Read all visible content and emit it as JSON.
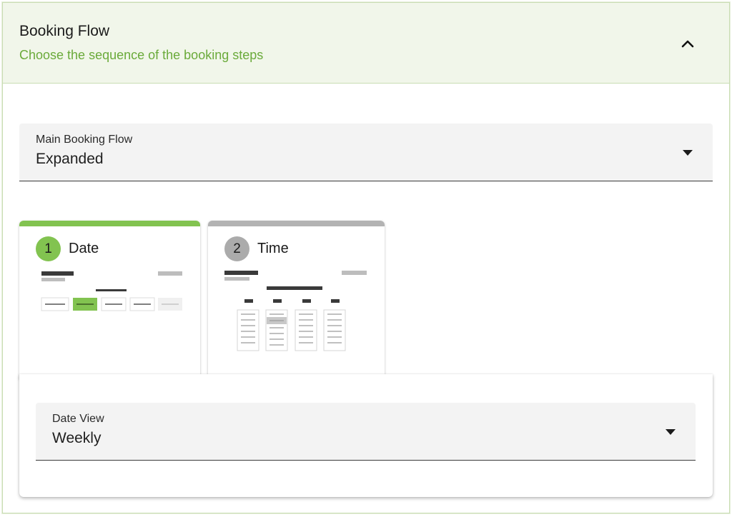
{
  "panel": {
    "title": "Booking Flow",
    "subtitle": "Choose the sequence of the booking steps",
    "collapse_icon": "chevron-up-icon"
  },
  "main_booking_flow": {
    "label": "Main Booking Flow",
    "value": "Expanded",
    "arrow_icon": "dropdown-arrow-icon"
  },
  "steps": [
    {
      "number": "1",
      "label": "Date",
      "status": "active",
      "color": "#82c350"
    },
    {
      "number": "2",
      "label": "Time",
      "status": "inactive",
      "color": "#b3b3b3"
    }
  ],
  "date_view": {
    "label": "Date View",
    "value": "Weekly",
    "arrow_icon": "dropdown-arrow-icon"
  },
  "colors": {
    "accent": "#82c350",
    "subtitle": "#6aaa3a",
    "header_bg": "#f1f6ea",
    "inactive": "#b3b3b3"
  }
}
